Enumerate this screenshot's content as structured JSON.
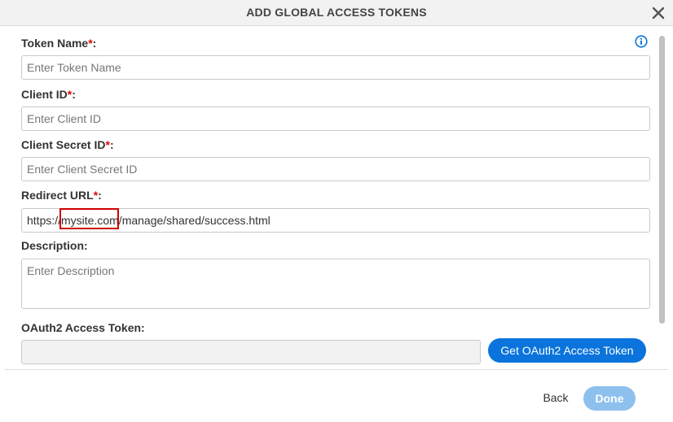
{
  "dialog": {
    "title": "ADD GLOBAL ACCESS TOKENS",
    "close_icon": "close-icon",
    "info_icon": "info-icon"
  },
  "fields": {
    "token_name": {
      "label": "Token Name",
      "required_mark": "*",
      "suffix": ":",
      "placeholder": "Enter Token Name",
      "value": ""
    },
    "client_id": {
      "label": "Client ID",
      "required_mark": "*",
      "suffix": ":",
      "placeholder": "Enter Client ID",
      "value": ""
    },
    "client_secret_id": {
      "label": "Client Secret ID",
      "required_mark": "*",
      "suffix": ":",
      "placeholder": "Enter Client Secret ID",
      "value": ""
    },
    "redirect_url": {
      "label": "Redirect URL",
      "required_mark": "*",
      "suffix": ":",
      "value": "https://mysite.com/manage/shared/success.html"
    },
    "description": {
      "label": "Description:",
      "placeholder": "Enter Description",
      "value": ""
    },
    "oauth2_token": {
      "label": "OAuth2 Access Token:",
      "value": ""
    }
  },
  "buttons": {
    "get_token": "Get OAuth2 Access Token",
    "back": "Back",
    "done": "Done"
  },
  "colors": {
    "primary": "#0a74dc",
    "done_disabled": "#8ec0ee",
    "required": "#e00000",
    "highlight": "#d00000"
  }
}
